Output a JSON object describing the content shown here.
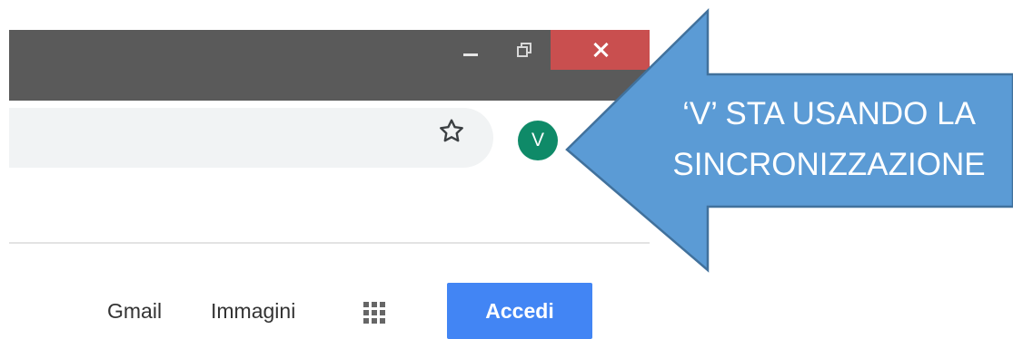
{
  "window": {
    "controls": {
      "minimize_icon": "minimize-icon",
      "maximize_icon": "restore-icon",
      "close_icon": "close-icon"
    },
    "titlebar_color": "#5a5a5a",
    "close_color": "#c94f4f"
  },
  "toolbar": {
    "bookmark_icon": "star-outline-icon",
    "profile": {
      "initial": "V",
      "color": "#0f8a68"
    }
  },
  "google_header": {
    "gmail_label": "Gmail",
    "images_label": "Immagini",
    "apps_icon": "apps-grid-icon",
    "signin_label": "Accedi",
    "signin_color": "#4285f4"
  },
  "callout": {
    "line1": "‘V’ STA USANDO LA",
    "line2": "SINCRONIZZAZIONE",
    "fill_color": "#5b9bd5",
    "border_color": "#41719c"
  }
}
